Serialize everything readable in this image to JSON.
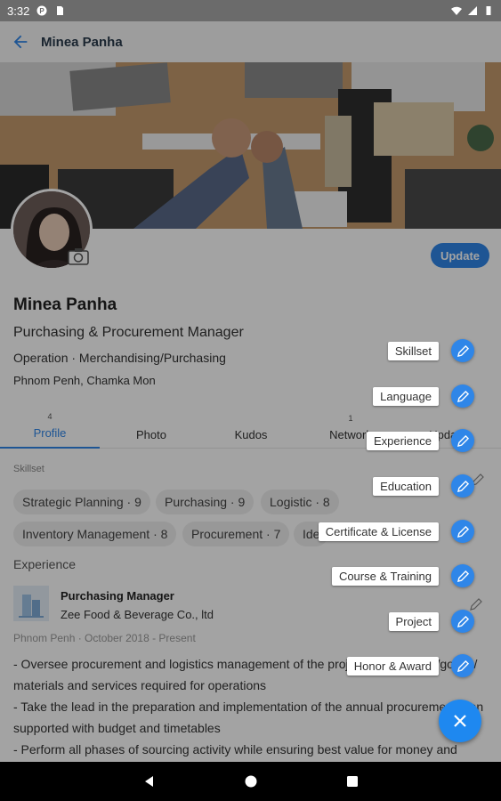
{
  "status_bar": {
    "time": "3:32"
  },
  "app_bar": {
    "title": "Minea Panha",
    "back_icon": "arrow-left-icon"
  },
  "profile": {
    "name": "Minea Panha",
    "job_title": "Purchasing & Procurement Manager",
    "department": "Operation · Merchandising/Purchasing",
    "location": "Phnom Penh, Chamka Mon",
    "update_label": "Update"
  },
  "tabs": [
    {
      "label": "Profile",
      "badge": "4"
    },
    {
      "label": "Photo",
      "badge": ""
    },
    {
      "label": "Kudos",
      "badge": ""
    },
    {
      "label": "Network",
      "badge": "1"
    },
    {
      "label": "Updates",
      "badge": ""
    }
  ],
  "skillset": {
    "label": "Skillset",
    "chips": [
      "Strategic Planning · 9",
      "Purchasing  · 9",
      "Logistic · 8",
      "Inventory Management · 8",
      "Procurement · 7",
      "Ide"
    ]
  },
  "experience": {
    "label": "Experience",
    "role": "Purchasing Manager",
    "company": "Zee Food & Beverage Co., ltd",
    "meta": "Phnom Penh  · October 2018 - Present",
    "description": "- Oversee procurement and logistics management of the projects: equipment/goods/ materials and services required for operations\n- Take the lead in the preparation and implementation of the annual procurement plan supported with budget and timetables\n- Perform all phases of sourcing activity while ensuring best value for money and"
  },
  "fab_menu": [
    {
      "label": "Skillset"
    },
    {
      "label": "Language"
    },
    {
      "label": "Experience"
    },
    {
      "label": "Education"
    },
    {
      "label": "Certificate & License"
    },
    {
      "label": "Course & Training"
    },
    {
      "label": "Project"
    },
    {
      "label": "Honor & Award"
    }
  ],
  "colors": {
    "accent": "#2f86e8",
    "scrim": "rgba(0,0,0,0.36)"
  }
}
